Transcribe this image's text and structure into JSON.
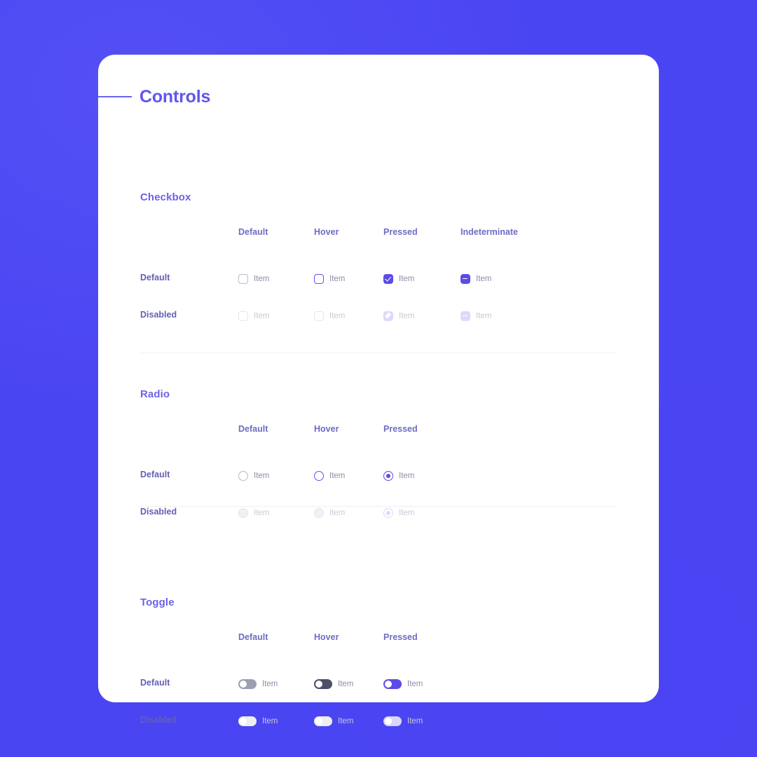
{
  "page": {
    "title": "Controls",
    "background_color": "#4a45f2",
    "accent_color": "#5b4ce5"
  },
  "sections": [
    {
      "id": "checkbox",
      "title": "Checkbox",
      "columns": [
        "Default",
        "Hover",
        "Pressed",
        "Indeterminate"
      ],
      "rows": [
        {
          "label": "Default",
          "cells": [
            {
              "state": "default",
              "label": "Item"
            },
            {
              "state": "hover",
              "label": "Item"
            },
            {
              "state": "pressed",
              "label": "Item"
            },
            {
              "state": "indeterminate",
              "label": "Item"
            }
          ]
        },
        {
          "label": "Disabled",
          "cells": [
            {
              "state": "default",
              "label": "Item"
            },
            {
              "state": "hover",
              "label": "Item"
            },
            {
              "state": "pressed",
              "label": "Item"
            },
            {
              "state": "indeterminate",
              "label": "Item"
            }
          ]
        }
      ]
    },
    {
      "id": "radio",
      "title": "Radio",
      "columns": [
        "Default",
        "Hover",
        "Pressed"
      ],
      "rows": [
        {
          "label": "Default",
          "cells": [
            {
              "state": "default",
              "label": "Item"
            },
            {
              "state": "hover",
              "label": "Item"
            },
            {
              "state": "pressed",
              "label": "Item"
            }
          ]
        },
        {
          "label": "Disabled",
          "cells": [
            {
              "state": "default",
              "label": "Item"
            },
            {
              "state": "hover",
              "label": "Item"
            },
            {
              "state": "pressed",
              "label": "Item"
            }
          ]
        }
      ]
    },
    {
      "id": "toggle",
      "title": "Toggle",
      "columns": [
        "Default",
        "Hover",
        "Pressed"
      ],
      "rows": [
        {
          "label": "Default",
          "cells": [
            {
              "state": "default",
              "label": "Item"
            },
            {
              "state": "hover",
              "label": "Item"
            },
            {
              "state": "pressed",
              "label": "Item"
            }
          ]
        },
        {
          "label": "Disabled",
          "cells": [
            {
              "state": "default",
              "label": "Item"
            },
            {
              "state": "hover",
              "label": "Item"
            },
            {
              "state": "pressed",
              "label": "Item"
            }
          ]
        }
      ]
    }
  ]
}
